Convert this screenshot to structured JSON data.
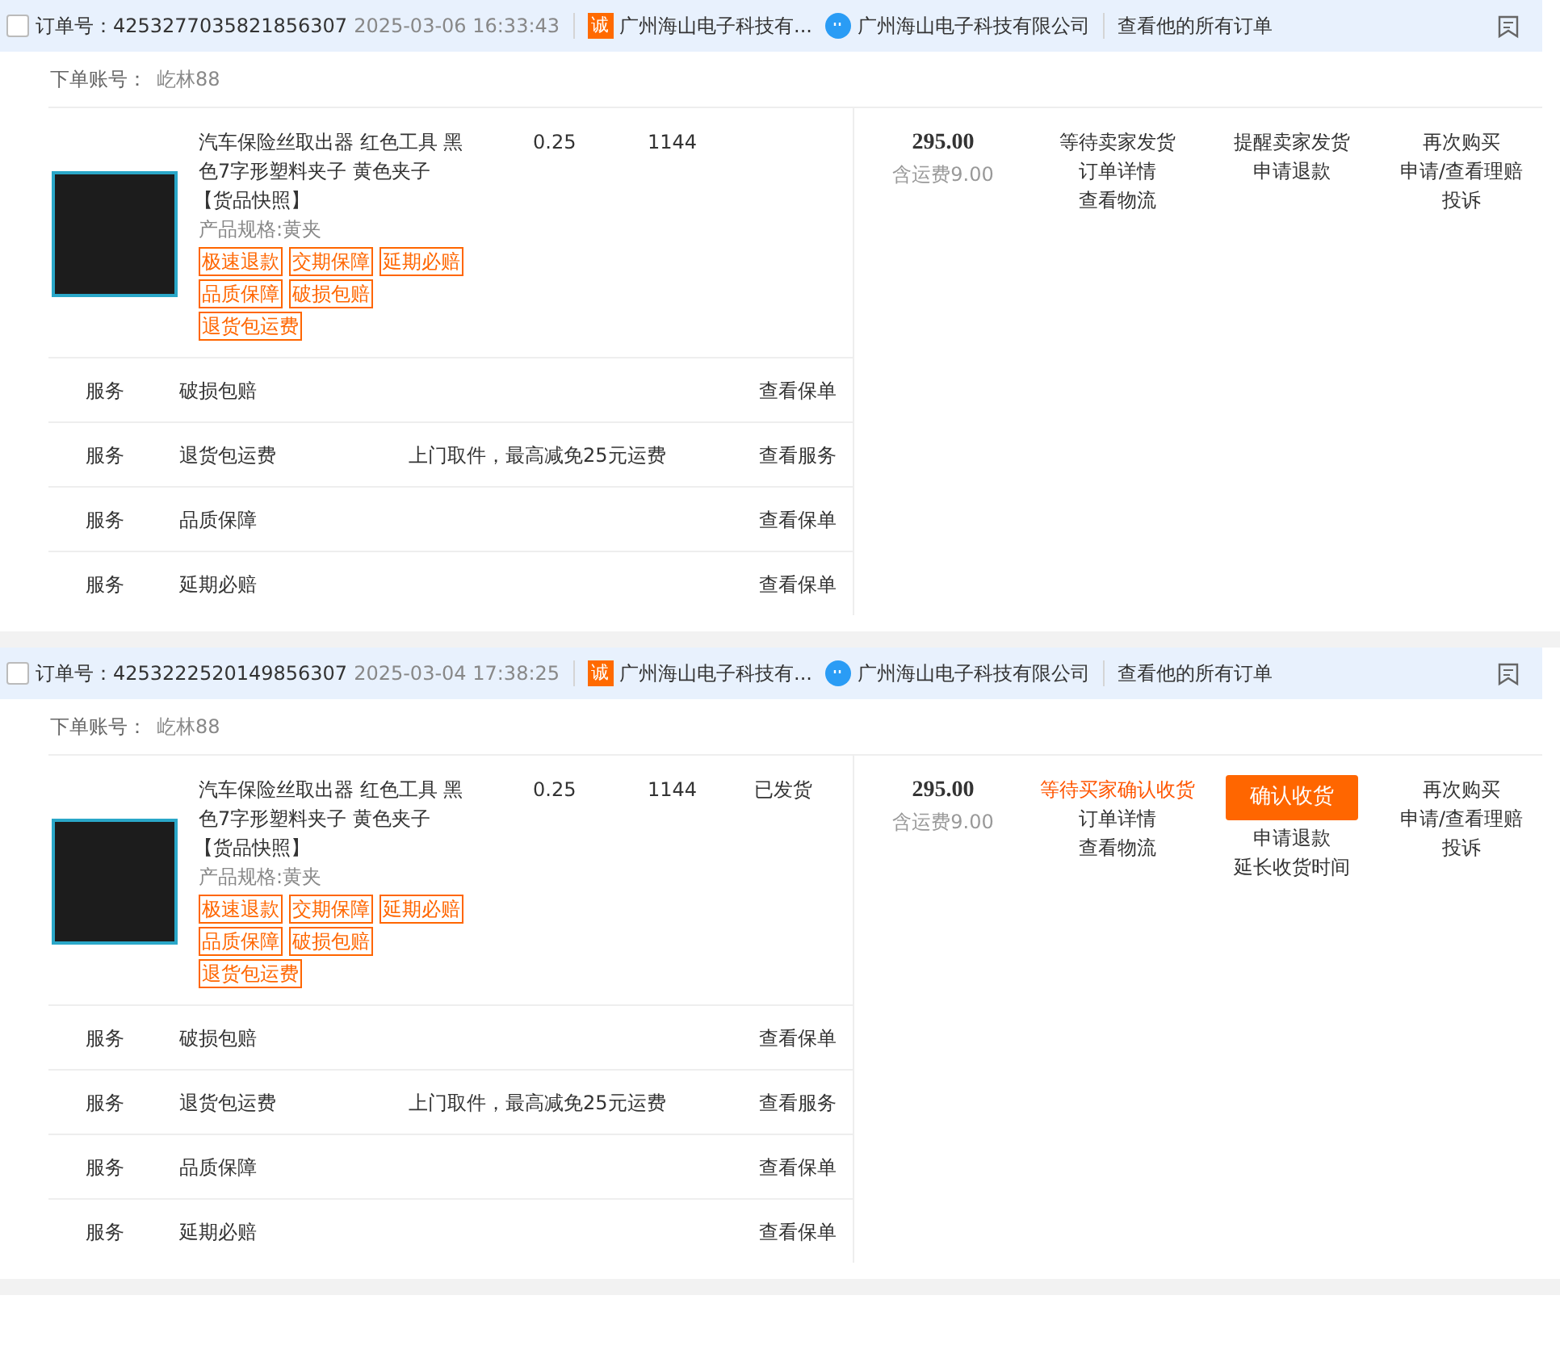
{
  "orders": [
    {
      "checked": false,
      "order_label": "订单号：",
      "order_no": "4253277035821856307",
      "time": "2025-03-06 16:33:43",
      "shop_badge": "诚",
      "shop": "广州海山电子科技有...",
      "seller": "广州海山电子科技有限公司",
      "view_all": "查看他的所有订单",
      "account_label": "下单账号：",
      "account": "屹林88",
      "item": {
        "title": "汽车保险丝取出器 红色工具 黑色7字形塑料夹子 黄色夹子",
        "snapshot": "【货品快照】",
        "spec": "产品规格:黄夹",
        "tags": [
          "极速退款",
          "交期保障",
          "延期必赔",
          "品质保障",
          "破损包赔",
          "退货包运费"
        ],
        "unit_price": "0.25",
        "quantity": "1144"
      },
      "services": [
        {
          "label": "服务",
          "name": "破损包赔",
          "action": "查看保单"
        },
        {
          "label": "服务",
          "name": "退货包运费",
          "note": "上门取件，最高减免25元运费",
          "action": "查看服务"
        },
        {
          "label": "服务",
          "name": "品质保障",
          "action": "查看保单"
        },
        {
          "label": "服务",
          "name": "延期必赔",
          "action": "查看保单"
        }
      ],
      "total": "295.00",
      "shipping": "含运费9.00",
      "status": {
        "text": "等待卖家发货",
        "highlight": false
      },
      "status_links": [
        "订单详情",
        "查看物流"
      ],
      "actions": [
        {
          "kind": "link",
          "label": "提醒卖家发货"
        },
        {
          "kind": "link",
          "label": "申请退款"
        }
      ],
      "more_links": [
        "再次购买",
        "申请/查看理赔",
        "投诉"
      ]
    },
    {
      "checked": false,
      "order_label": "订单号：",
      "order_no": "4253222520149856307",
      "time": "2025-03-04 17:38:25",
      "shop_badge": "诚",
      "shop": "广州海山电子科技有...",
      "seller": "广州海山电子科技有限公司",
      "view_all": "查看他的所有订单",
      "account_label": "下单账号：",
      "account": "屹林88",
      "item": {
        "title": "汽车保险丝取出器 红色工具 黑色7字形塑料夹子 黄色夹子",
        "snapshot": "【货品快照】",
        "spec": "产品规格:黄夹",
        "tags": [
          "极速退款",
          "交期保障",
          "延期必赔",
          "品质保障",
          "破损包赔",
          "退货包运费"
        ],
        "unit_price": "0.25",
        "quantity": "1144",
        "ship_status": "已发货"
      },
      "services": [
        {
          "label": "服务",
          "name": "破损包赔",
          "action": "查看保单"
        },
        {
          "label": "服务",
          "name": "退货包运费",
          "note": "上门取件，最高减免25元运费",
          "action": "查看服务"
        },
        {
          "label": "服务",
          "name": "品质保障",
          "action": "查看保单"
        },
        {
          "label": "服务",
          "name": "延期必赔",
          "action": "查看保单"
        }
      ],
      "total": "295.00",
      "shipping": "含运费9.00",
      "status": {
        "text": "等待买家确认收货",
        "highlight": true
      },
      "status_links": [
        "订单详情",
        "查看物流"
      ],
      "actions": [
        {
          "kind": "button",
          "label": "确认收货"
        },
        {
          "kind": "link",
          "label": "申请退款"
        },
        {
          "kind": "link",
          "label": "延长收货时间"
        }
      ],
      "more_links": [
        "再次购买",
        "申请/查看理赔",
        "投诉"
      ]
    }
  ]
}
